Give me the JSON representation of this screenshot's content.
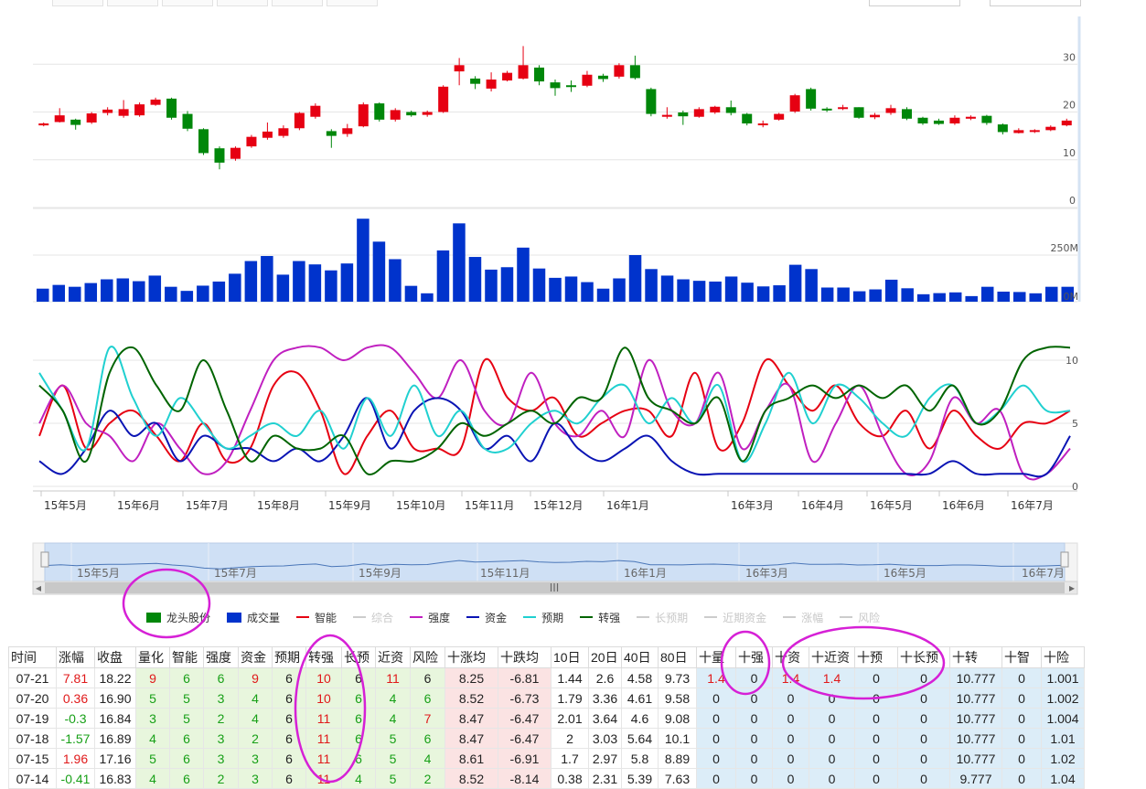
{
  "chart_data": [
    {
      "type": "candlestick",
      "title": "",
      "y_ticks": [
        "30",
        "20",
        "10",
        "0"
      ],
      "ylim": [
        0,
        40
      ],
      "grid": true,
      "colors": {
        "up": "#e60012",
        "down": "#00870a"
      },
      "candles": [
        [
          17.2,
          17.6,
          17.0,
          17.8
        ],
        [
          17.9,
          19.3,
          17.8,
          20.8
        ],
        [
          18.4,
          17.3,
          16.3,
          18.6
        ],
        [
          17.8,
          19.7,
          17.5,
          20.0
        ],
        [
          19.8,
          20.5,
          19.3,
          21.0
        ],
        [
          19.2,
          20.6,
          18.8,
          22.5
        ],
        [
          19.3,
          21.6,
          19.0,
          22.0
        ],
        [
          21.5,
          22.6,
          21.3,
          23.0
        ],
        [
          22.8,
          18.8,
          18.4,
          23.0
        ],
        [
          19.6,
          16.5,
          16.0,
          20.2
        ],
        [
          16.4,
          11.4,
          11.0,
          16.6
        ],
        [
          12.4,
          9.4,
          8.0,
          12.8
        ],
        [
          10.2,
          12.5,
          9.8,
          12.8
        ],
        [
          12.8,
          14.8,
          12.5,
          15.2
        ],
        [
          14.6,
          15.9,
          14.2,
          17.8
        ],
        [
          15.0,
          16.6,
          14.6,
          17.2
        ],
        [
          16.6,
          19.8,
          16.2,
          20.0
        ],
        [
          19.0,
          21.3,
          18.6,
          21.8
        ],
        [
          16.0,
          15.0,
          12.5,
          16.4
        ],
        [
          15.4,
          16.6,
          14.8,
          17.5
        ],
        [
          17.0,
          21.6,
          16.8,
          22.0
        ],
        [
          21.8,
          18.4,
          18.0,
          22.0
        ],
        [
          18.4,
          20.4,
          18.0,
          20.8
        ],
        [
          20.0,
          19.3,
          19.0,
          20.3
        ],
        [
          19.4,
          20.0,
          19.0,
          20.3
        ],
        [
          20.0,
          25.3,
          19.8,
          25.6
        ],
        [
          28.5,
          29.8,
          25.6,
          31.3
        ],
        [
          27.0,
          25.9,
          24.8,
          27.5
        ],
        [
          24.9,
          26.8,
          24.3,
          28.3
        ],
        [
          26.6,
          28.2,
          26.4,
          28.6
        ],
        [
          27.0,
          29.8,
          26.8,
          33.8
        ],
        [
          29.3,
          26.4,
          25.6,
          29.8
        ],
        [
          26.2,
          25.0,
          23.4,
          26.8
        ],
        [
          25.6,
          25.5,
          24.2,
          26.6
        ],
        [
          25.5,
          27.8,
          25.2,
          28.6
        ],
        [
          27.6,
          26.9,
          26.3,
          28.0
        ],
        [
          27.4,
          29.8,
          27.0,
          30.2
        ],
        [
          29.8,
          27.1,
          26.8,
          31.8
        ],
        [
          24.8,
          19.6,
          19.1,
          25.1
        ],
        [
          19.0,
          19.4,
          18.6,
          21.0
        ],
        [
          19.9,
          19.1,
          17.3,
          20.3
        ],
        [
          19.0,
          20.6,
          18.8,
          21.0
        ],
        [
          19.9,
          21.1,
          19.6,
          21.3
        ],
        [
          21.0,
          19.8,
          19.3,
          22.4
        ],
        [
          19.6,
          17.6,
          17.2,
          19.8
        ],
        [
          17.3,
          17.6,
          16.8,
          18.2
        ],
        [
          18.4,
          19.6,
          18.2,
          19.8
        ],
        [
          20.1,
          23.5,
          19.8,
          23.8
        ],
        [
          24.8,
          20.7,
          20.3,
          25.1
        ],
        [
          20.7,
          20.4,
          20.0,
          21.0
        ],
        [
          20.8,
          21.0,
          20.4,
          21.5
        ],
        [
          21.0,
          18.8,
          18.6,
          21.0
        ],
        [
          18.9,
          19.4,
          18.5,
          19.8
        ],
        [
          19.8,
          20.8,
          19.4,
          21.5
        ],
        [
          20.6,
          18.6,
          18.3,
          21.0
        ],
        [
          18.8,
          17.6,
          17.3,
          19.0
        ],
        [
          18.2,
          17.5,
          17.3,
          18.6
        ],
        [
          17.6,
          18.8,
          17.3,
          19.3
        ],
        [
          18.6,
          19.0,
          18.3,
          19.3
        ],
        [
          19.2,
          17.7,
          17.3,
          19.4
        ],
        [
          17.4,
          15.8,
          15.3,
          17.6
        ],
        [
          15.6,
          16.2,
          15.5,
          16.6
        ],
        [
          16.0,
          16.2,
          15.6,
          16.4
        ],
        [
          16.2,
          16.9,
          16.0,
          17.2
        ],
        [
          17.2,
          18.2,
          17.0,
          18.6
        ]
      ]
    },
    {
      "type": "bar",
      "title": "",
      "y_ticks": [
        "250M",
        "0M"
      ],
      "ylim": [
        0,
        500
      ],
      "values": [
        70,
        90,
        80,
        100,
        120,
        125,
        110,
        140,
        80,
        58,
        86,
        108,
        150,
        218,
        245,
        145,
        218,
        200,
        168,
        205,
        445,
        322,
        228,
        85,
        45,
        275,
        420,
        240,
        172,
        185,
        290,
        178,
        128,
        135,
        105,
        70,
        125,
        250,
        175,
        140,
        120,
        112,
        108,
        135,
        102,
        82,
        88,
        198,
        175,
        76,
        76,
        56,
        66,
        118,
        72,
        40,
        46,
        50,
        30,
        80,
        54,
        52,
        45,
        80,
        80
      ]
    },
    {
      "type": "line",
      "title": "",
      "y_ticks": [
        "10",
        "5",
        "0"
      ],
      "ylim": [
        0,
        10
      ],
      "x_ticks": [
        "15年5月",
        "15年6月",
        "15年7月",
        "15年8月",
        "15年9月",
        "15年10月",
        "15年11月",
        "15年12月",
        "16年1月",
        "16年3月",
        "16年4月",
        "16年5月",
        "16年6月",
        "16年7月"
      ],
      "series": [
        {
          "name": "智能",
          "color": "#e60012",
          "values": [
            4,
            8,
            3,
            5,
            6,
            4,
            2,
            5,
            2,
            3,
            8,
            9,
            6,
            1,
            4,
            6,
            3,
            3,
            3,
            10,
            7,
            6,
            7,
            4,
            5,
            6,
            6,
            4,
            9,
            3,
            5,
            10,
            8,
            6,
            8,
            5,
            4,
            6,
            3,
            6,
            4,
            3,
            5,
            5,
            6
          ]
        },
        {
          "name": "强度",
          "color": "#c020c0",
          "values": [
            5,
            8,
            5,
            4,
            2,
            5,
            3,
            1,
            2,
            6,
            10,
            11,
            11,
            10,
            11,
            11,
            9,
            7,
            10,
            6,
            5,
            9,
            5,
            4,
            6,
            4,
            10,
            6,
            5,
            9,
            3,
            6,
            8,
            2,
            5,
            8,
            4,
            1,
            2,
            7,
            5,
            6,
            1,
            1,
            3
          ]
        },
        {
          "name": "资金",
          "color": "#0a14b4",
          "values": [
            2,
            1,
            3,
            6,
            4,
            5,
            2,
            4,
            3,
            3,
            2,
            3,
            2,
            4,
            7,
            3,
            6,
            7,
            6,
            3,
            4,
            2,
            5,
            3,
            2,
            3,
            4,
            2,
            1,
            1,
            1,
            1,
            1,
            1,
            1,
            1,
            1,
            1,
            1,
            2,
            1,
            1,
            1,
            1,
            4
          ]
        },
        {
          "name": "预期",
          "color": "#20d0d0",
          "values": [
            9,
            6,
            3,
            11,
            7,
            4,
            7,
            5,
            3,
            4,
            5,
            4,
            6,
            3,
            7,
            4,
            8,
            4,
            6,
            3,
            3,
            5,
            6,
            5,
            7,
            8,
            5,
            7,
            5,
            8,
            2,
            5,
            9,
            5,
            8,
            7,
            5,
            4,
            7,
            8,
            5,
            6,
            8,
            6,
            6
          ]
        },
        {
          "name": "转强",
          "color": "#006400",
          "values": [
            8,
            6,
            2,
            9,
            11,
            8,
            6,
            10,
            6,
            2,
            4,
            3,
            3,
            4,
            1,
            2,
            2,
            3,
            5,
            4,
            5,
            6,
            5,
            7,
            7,
            11,
            7,
            6,
            5,
            7,
            2,
            6,
            7,
            8,
            7,
            8,
            7,
            8,
            6,
            8,
            5,
            6,
            10,
            11,
            11
          ]
        }
      ]
    }
  ],
  "navigator": {
    "labels": [
      "15年5月",
      "15年7月",
      "15年9月",
      "15年11月",
      "16年1月",
      "16年3月",
      "16年5月",
      "16年7月"
    ],
    "handle_glyph": "III",
    "scroll_left": "◂",
    "scroll_right": "▸"
  },
  "legend": [
    {
      "label": "龙头股份",
      "symbol": "box",
      "color": "#00870a",
      "enabled": true
    },
    {
      "label": "成交量",
      "symbol": "box",
      "color": "#0033cc",
      "enabled": true
    },
    {
      "label": "智能",
      "symbol": "line",
      "color": "#e60012",
      "enabled": true
    },
    {
      "label": "综合",
      "symbol": "line",
      "color": "#cccccc",
      "enabled": false
    },
    {
      "label": "强度",
      "symbol": "line",
      "color": "#c020c0",
      "enabled": true
    },
    {
      "label": "资金",
      "symbol": "line",
      "color": "#0a14b4",
      "enabled": true
    },
    {
      "label": "预期",
      "symbol": "line",
      "color": "#20d0d0",
      "enabled": true
    },
    {
      "label": "转强",
      "symbol": "line",
      "color": "#006400",
      "enabled": true
    },
    {
      "label": "长预期",
      "symbol": "line",
      "color": "#cccccc",
      "enabled": false
    },
    {
      "label": "近期资金",
      "symbol": "line",
      "color": "#cccccc",
      "enabled": false
    },
    {
      "label": "涨幅",
      "symbol": "line",
      "color": "#cccccc",
      "enabled": false
    },
    {
      "label": "风险",
      "symbol": "line",
      "color": "#cccccc",
      "enabled": false
    }
  ],
  "table": {
    "headers": [
      "时间",
      "涨幅",
      "收盘",
      "量化",
      "智能",
      "强度",
      "资金",
      "预期",
      "转强",
      "长预",
      "近资",
      "风险",
      "十涨均",
      "十跌均",
      "10日",
      "20日",
      "40日",
      "80日",
      "十量",
      "十强",
      "十资",
      "十近资",
      "十预",
      "十长预",
      "十转",
      "十智",
      "十险"
    ],
    "rows": [
      [
        "07-21",
        "7.81",
        "18.22",
        "9",
        "6",
        "6",
        "9",
        "6",
        "10",
        "6",
        "11",
        "6",
        "8.25",
        "-6.81",
        "1.44",
        "2.6",
        "4.58",
        "9.73",
        "1.4",
        "0",
        "1.4",
        "1.4",
        "0",
        "0",
        "10.777",
        "0",
        "1.001"
      ],
      [
        "07-20",
        "0.36",
        "16.90",
        "5",
        "5",
        "3",
        "4",
        "6",
        "10",
        "6",
        "4",
        "6",
        "8.52",
        "-6.73",
        "1.79",
        "3.36",
        "4.61",
        "9.58",
        "0",
        "0",
        "0",
        "0",
        "0",
        "0",
        "10.777",
        "0",
        "1.002"
      ],
      [
        "07-19",
        "-0.3",
        "16.84",
        "3",
        "5",
        "2",
        "4",
        "6",
        "11",
        "6",
        "4",
        "7",
        "8.47",
        "-6.47",
        "2.01",
        "3.64",
        "4.6",
        "9.08",
        "0",
        "0",
        "0",
        "0",
        "0",
        "0",
        "10.777",
        "0",
        "1.004"
      ],
      [
        "07-18",
        "-1.57",
        "16.89",
        "4",
        "6",
        "3",
        "2",
        "6",
        "11",
        "6",
        "5",
        "6",
        "8.47",
        "-6.47",
        "2",
        "3.03",
        "5.64",
        "10.1",
        "0",
        "0",
        "0",
        "0",
        "0",
        "0",
        "10.777",
        "0",
        "1.01"
      ],
      [
        "07-15",
        "1.96",
        "17.16",
        "5",
        "6",
        "3",
        "3",
        "6",
        "11",
        "6",
        "5",
        "4",
        "8.61",
        "-6.91",
        "1.7",
        "2.97",
        "5.8",
        "8.89",
        "0",
        "0",
        "0",
        "0",
        "0",
        "0",
        "10.777",
        "0",
        "1.02"
      ],
      [
        "07-14",
        "-0.41",
        "16.83",
        "4",
        "6",
        "2",
        "3",
        "6",
        "11",
        "4",
        "5",
        "2",
        "8.52",
        "-8.14",
        "0.38",
        "2.31",
        "5.39",
        "7.63",
        "0",
        "0",
        "0",
        "0",
        "0",
        "0",
        "9.777",
        "0",
        "1.04"
      ]
    ],
    "red_cells": [
      [
        0,
        1
      ],
      [
        0,
        3
      ],
      [
        0,
        6
      ],
      [
        0,
        8
      ],
      [
        0,
        10
      ],
      [
        1,
        1
      ],
      [
        1,
        8
      ],
      [
        2,
        8
      ],
      [
        2,
        11
      ],
      [
        3,
        8
      ],
      [
        4,
        1
      ],
      [
        4,
        8
      ],
      [
        5,
        8
      ],
      [
        0,
        18
      ],
      [
        0,
        20
      ],
      [
        0,
        21
      ]
    ],
    "green_cells": [
      [
        0,
        4
      ],
      [
        0,
        5
      ],
      [
        1,
        3
      ],
      [
        1,
        4
      ],
      [
        1,
        5
      ],
      [
        1,
        6
      ],
      [
        1,
        9
      ],
      [
        1,
        10
      ],
      [
        1,
        11
      ],
      [
        2,
        1
      ],
      [
        2,
        3
      ],
      [
        2,
        4
      ],
      [
        2,
        5
      ],
      [
        2,
        6
      ],
      [
        2,
        9
      ],
      [
        2,
        10
      ],
      [
        3,
        1
      ],
      [
        3,
        3
      ],
      [
        3,
        4
      ],
      [
        3,
        5
      ],
      [
        3,
        6
      ],
      [
        3,
        9
      ],
      [
        3,
        10
      ],
      [
        3,
        11
      ],
      [
        4,
        3
      ],
      [
        4,
        4
      ],
      [
        4,
        5
      ],
      [
        4,
        6
      ],
      [
        4,
        9
      ],
      [
        4,
        10
      ],
      [
        4,
        11
      ],
      [
        5,
        1
      ],
      [
        5,
        3
      ],
      [
        5,
        4
      ],
      [
        5,
        5
      ],
      [
        5,
        6
      ],
      [
        5,
        9
      ],
      [
        5,
        10
      ],
      [
        5,
        11
      ]
    ]
  },
  "annotation_color": "#d620d6"
}
